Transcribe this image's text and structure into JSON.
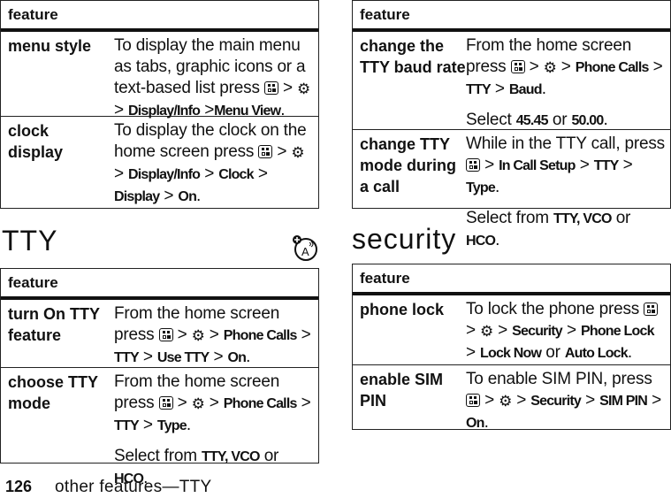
{
  "tables": {
    "display": {
      "header": "feature",
      "rows": [
        {
          "feature": "menu style",
          "desc": [
            "To display the main menu as tabs, graphic icons or a text-based list press",
            ">",
            ">",
            "Display/Info",
            ">",
            "Menu View",
            "."
          ]
        },
        {
          "feature": "clock display",
          "desc": [
            "To display the clock on the home screen press",
            ">",
            ">",
            "Display/Info",
            ">",
            "Clock",
            ">",
            "Display",
            ">",
            "On",
            "."
          ]
        }
      ]
    },
    "tty": {
      "header": "feature",
      "rows": [
        {
          "feature": "turn On TTY feature",
          "p1": "From the home screen press",
          "path": [
            "Phone Calls",
            "TTY",
            "Use TTY",
            "On"
          ]
        },
        {
          "feature": "choose TTY mode",
          "p1": "From the home screen press",
          "path": [
            "Phone Calls",
            "TTY",
            "Type"
          ],
          "p2_prefix": "Select from",
          "p2_opts": "TTY, VCO",
          "p2_or": "or",
          "p2_last": "HCO"
        }
      ]
    },
    "tty2": {
      "header": "feature",
      "rows": [
        {
          "feature": "change the TTY baud rate",
          "p1": "From the home screen press",
          "path": [
            "Phone Calls",
            "TTY",
            "Baud"
          ],
          "p2_prefix": "Select",
          "p2_a": "45.45",
          "p2_or": "or",
          "p2_b": "50.00"
        },
        {
          "feature": "change TTY mode during a call",
          "p1": "While in the TTY call, press",
          "path": [
            "In Call Setup",
            "TTY",
            "Type"
          ],
          "p2_prefix": "Select from",
          "p2_opts": "TTY, VCO",
          "p2_or": "or",
          "p2_last": "HCO"
        }
      ]
    },
    "security": {
      "header": "feature",
      "rows": [
        {
          "feature": "phone lock",
          "p1": "To lock the phone press",
          "path": [
            "Security",
            "Phone Lock",
            "Lock Now"
          ],
          "or": "or",
          "last": "Auto Lock"
        },
        {
          "feature": "enable SIM PIN",
          "p1": "To enable SIM PIN, press",
          "path": [
            "Security",
            "SIM PIN",
            "On"
          ]
        }
      ]
    }
  },
  "sections": {
    "tty_title": "TTY",
    "security_title": "security"
  },
  "icons": {
    "menu_key": "menu-key-icon",
    "settings": "settings-gear-wrench-icon",
    "tty_feature": "network-feature-icon"
  },
  "footer": {
    "page_number": "126",
    "text": "other features—TTY"
  },
  "sep": ">",
  "dot": "."
}
